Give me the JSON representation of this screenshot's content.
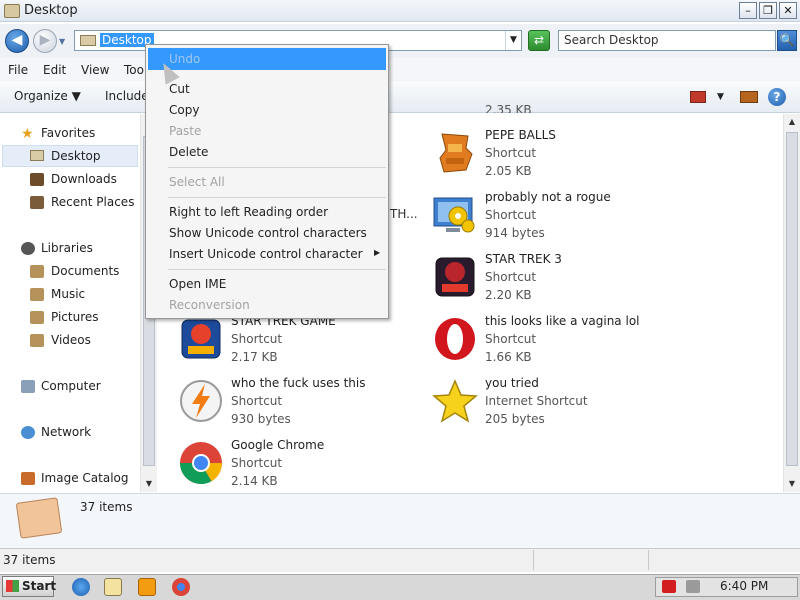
{
  "window": {
    "title": "Desktop"
  },
  "address": {
    "location": "Desktop",
    "search_placeholder": "Search Desktop"
  },
  "menu": [
    "File",
    "Edit",
    "View",
    "Too"
  ],
  "toolbar": {
    "organize": "Organize",
    "include": "Include"
  },
  "nav": {
    "favorites": "Favorites",
    "desktop": "Desktop",
    "downloads": "Downloads",
    "recent_places": "Recent Places",
    "libraries": "Libraries",
    "documents": "Documents",
    "music": "Music",
    "pictures": "Pictures",
    "videos": "Videos",
    "computer": "Computer",
    "network": "Network",
    "image_catalog": "Image Catalog"
  },
  "files": [
    {
      "name": "PEPE BALLS",
      "type": "Shortcut",
      "size": "2.05 KB",
      "icon": "pepe-icon"
    },
    {
      "name": "probably not a rogue",
      "type": "Shortcut",
      "size": "914 bytes",
      "icon": "gears-icon"
    },
    {
      "name": "STAR TREK 3",
      "type": "Shortcut",
      "size": "2.20 KB",
      "icon": "star-wars-icon"
    },
    {
      "name": "STAR TREK GAME",
      "type": "Shortcut",
      "size": "2.17 KB",
      "icon": "star-wars-icon"
    },
    {
      "name": "this looks like a vagina lol",
      "type": "Shortcut",
      "size": "1.66 KB",
      "icon": "opera-icon"
    },
    {
      "name": "who the fuck uses this",
      "type": "Shortcut",
      "size": "930 bytes",
      "icon": "bolt-icon"
    },
    {
      "name": "you tried",
      "type": "Internet Shortcut",
      "size": "205 bytes",
      "icon": "star-icon"
    },
    {
      "name": "Google Chrome",
      "type": "Shortcut",
      "size": "2.14 KB",
      "icon": "chrome-icon"
    }
  ],
  "partial_size": "2.35 KB",
  "hidden_text": "TH...",
  "details": {
    "count": "37 items"
  },
  "status": {
    "count": "37 items"
  },
  "taskbar": {
    "start": "Start",
    "clock": "6:40 PM"
  },
  "context_menu": {
    "undo": "Undo",
    "cut": "Cut",
    "copy": "Copy",
    "paste": "Paste",
    "delete": "Delete",
    "select_all": "Select All",
    "rtl": "Right to left Reading order",
    "show_unicode": "Show Unicode control characters",
    "insert_unicode": "Insert Unicode control character",
    "open_ime": "Open IME",
    "reconversion": "Reconversion"
  },
  "colors": {
    "highlight": "#3399ff",
    "accent": "#1d5fae"
  }
}
